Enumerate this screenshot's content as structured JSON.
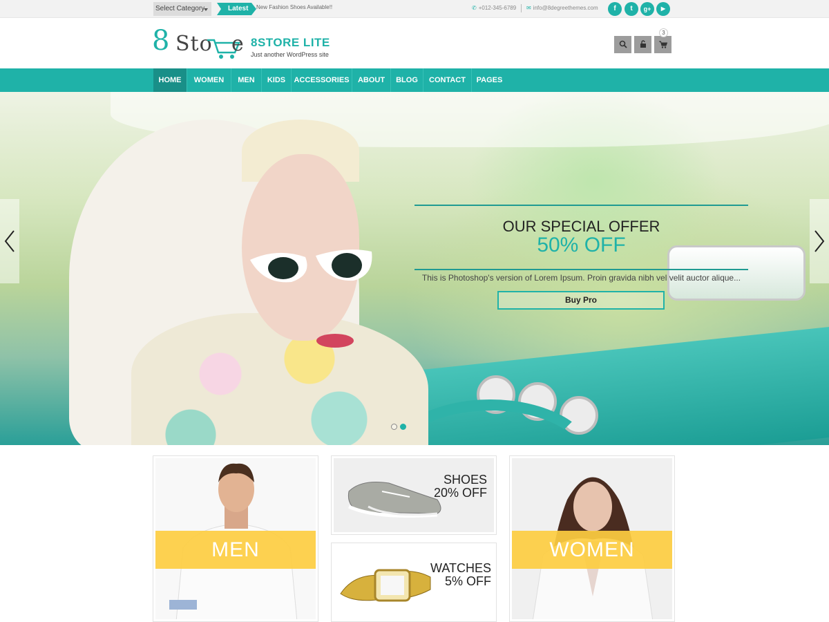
{
  "topbar": {
    "category_select": "Select Category",
    "latest_label": "Latest",
    "ticker_text": "New Fashion Shoes Available!!",
    "phone": "+012-345-6789",
    "email": "info@8degreethemes.com",
    "social": [
      {
        "name": "facebook-icon",
        "glyph": "f"
      },
      {
        "name": "twitter-icon",
        "glyph": "t"
      },
      {
        "name": "google-plus-icon",
        "glyph": "g+"
      },
      {
        "name": "youtube-icon",
        "glyph": "▶"
      }
    ]
  },
  "header": {
    "logo_digit": "8",
    "logo_word": "Sto",
    "logo_tail": "e",
    "site_title": "8STORE LITE",
    "tagline": "Just another WordPress site",
    "cart_count": "3",
    "icons": [
      "search-icon",
      "lock-icon",
      "cart-icon"
    ]
  },
  "nav": {
    "items": [
      "HOME",
      "WOMEN",
      "MEN",
      "KIDS",
      "ACCESSORIES",
      "ABOUT",
      "BLOG",
      "CONTACT",
      "PAGES"
    ],
    "active": "HOME"
  },
  "hero": {
    "title": "OUR SPECIAL OFFER",
    "subtitle": "50% OFF",
    "description": "This is Photoshop's version of Lorem Ipsum. Proin gravida nibh vel velit auctor alique...",
    "button": "Buy Pro",
    "slides": 2,
    "active_slide": 2
  },
  "promos": {
    "men": "MEN",
    "women": "WOMEN",
    "shoes": {
      "line1": "SHOES",
      "line2": "20% OFF"
    },
    "watches": {
      "line1": "WATCHES",
      "line2": "5% OFF"
    }
  },
  "colors": {
    "accent": "#1fb2a8",
    "accent_dark": "#198f88",
    "band": "#fdcd41"
  }
}
